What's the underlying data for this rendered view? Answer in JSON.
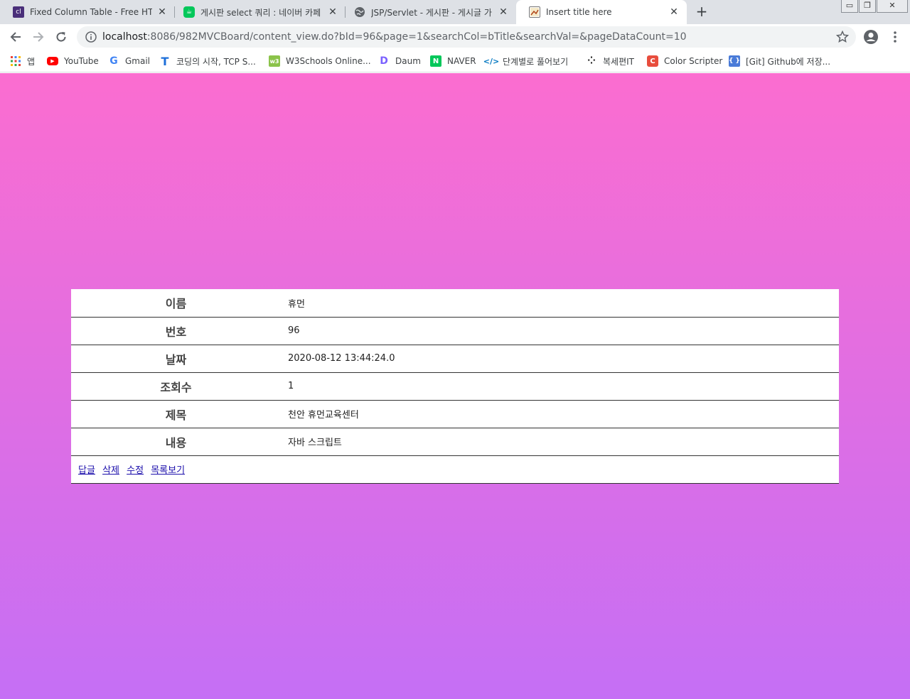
{
  "browser": {
    "tabs": [
      {
        "title": "Fixed Column Table - Free HTML",
        "favicon": "colorlib-icon",
        "active": false
      },
      {
        "title": "게시판 select 쿼리 : 네이버 카페",
        "favicon": "naver-cafe-icon",
        "active": false
      },
      {
        "title": "JSP/Servlet - 게시판 - 게시글 가",
        "favicon": "globe-icon",
        "active": false
      },
      {
        "title": "Insert title here",
        "favicon": "page-icon",
        "active": true
      }
    ],
    "url_host": "localhost",
    "url_path": ":8086/982MVCBoard/content_view.do?bId=96&page=1&searchCol=bTitle&searchVal=&pageDataCount=10",
    "bookmarks": [
      {
        "label": "앱",
        "icon": "apps-grid-icon"
      },
      {
        "label": "YouTube",
        "icon": "youtube-icon"
      },
      {
        "label": "Gmail",
        "icon": "google-icon"
      },
      {
        "label": "코딩의 시작, TCP S...",
        "icon": "tcp-school-icon"
      },
      {
        "label": "W3Schools Online...",
        "icon": "w3schools-icon"
      },
      {
        "label": "Daum",
        "icon": "daum-icon"
      },
      {
        "label": "NAVER",
        "icon": "naver-icon"
      },
      {
        "label": "단계별로 풀어보기",
        "icon": "code-icon"
      },
      {
        "label": "복세편IT",
        "icon": "dots-icon"
      },
      {
        "label": "Color Scripter",
        "icon": "color-scripter-icon"
      },
      {
        "label": "[Git] Github에 저장...",
        "icon": "github-doc-icon"
      }
    ]
  },
  "board": {
    "rows": [
      {
        "label": "이름",
        "value": "휴먼"
      },
      {
        "label": "번호",
        "value": "96"
      },
      {
        "label": "날짜",
        "value": "2020-08-12 13:44:24.0"
      },
      {
        "label": "조회수",
        "value": "1"
      },
      {
        "label": "제목",
        "value": "천안 휴먼교육센터"
      },
      {
        "label": "내용",
        "value": "자바 스크립트"
      }
    ],
    "actions": {
      "reply": "답글",
      "delete": "삭제",
      "edit": "수정",
      "list": "목록보기"
    }
  },
  "colors": {
    "gradient_top": "#fb6dd0",
    "gradient_bottom": "#c56ff5"
  }
}
